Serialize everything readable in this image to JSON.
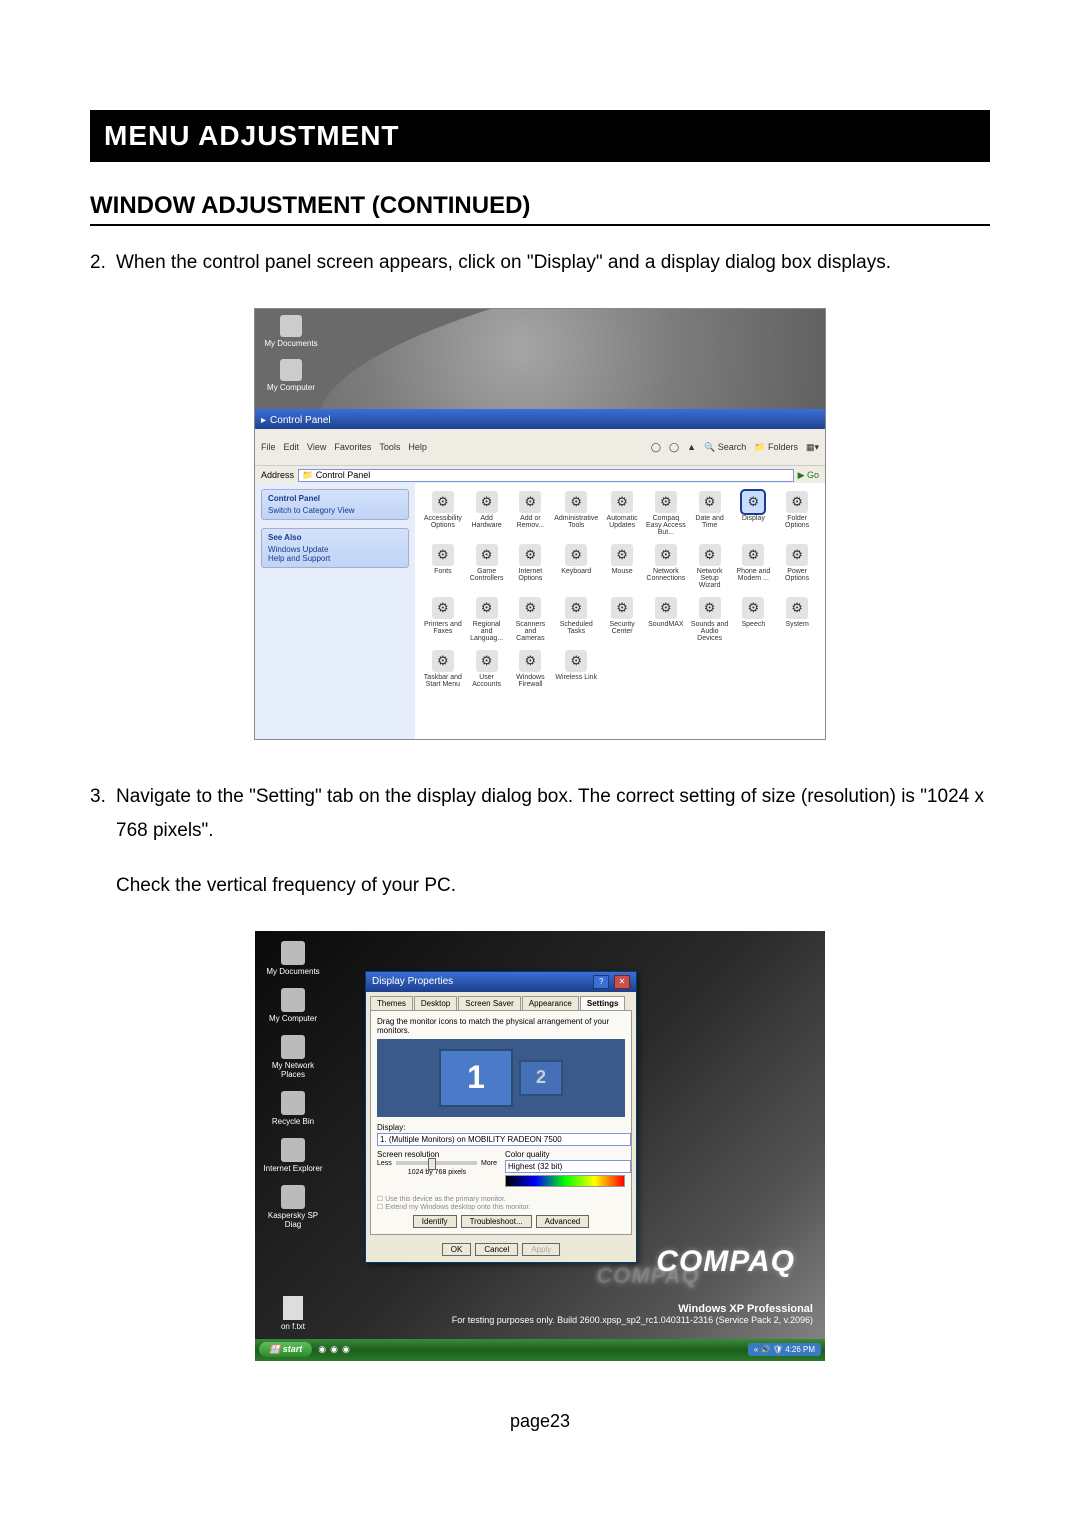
{
  "section_header": "MENU ADJUSTMENT",
  "sub_header": "WINDOW ADJUSTMENT (CONTINUED)",
  "step2_num": "2.",
  "step2_text": "When the control panel screen appears, click on \"Display\" and a display dialog box displays.",
  "step3_num": "3.",
  "step3_text": "Navigate to the \"Setting\" tab on the display dialog box. The correct setting of size (resolution) is \"1024 x 768 pixels\".",
  "step3_text2": "Check the vertical frequency of your PC.",
  "page_number": "page23",
  "cp": {
    "desktop_icons": [
      "My Documents",
      "My Computer"
    ],
    "window_title": "Control Panel",
    "menu": [
      "File",
      "Edit",
      "View",
      "Favorites",
      "Tools",
      "Help"
    ],
    "toolbar": [
      "Back",
      "Search",
      "Folders"
    ],
    "address_label": "Address",
    "address_value": "Control Panel",
    "sidebar_panel1_hdr": "Control Panel",
    "sidebar_panel1_link": "Switch to Category View",
    "sidebar_panel2_hdr": "See Also",
    "sidebar_panel2_links": [
      "Windows Update",
      "Help and Support"
    ],
    "icons": [
      "Accessibility Options",
      "Add Hardware",
      "Add or Remov...",
      "Administrative Tools",
      "Automatic Updates",
      "Compaq Easy Access But...",
      "Date and Time",
      "Display",
      "Folder Options",
      "Fonts",
      "Game Controllers",
      "Internet Options",
      "Keyboard",
      "Mouse",
      "Network Connections",
      "Network Setup Wizard",
      "Phone and Modem ...",
      "Power Options",
      "Printers and Faxes",
      "Regional and Languag...",
      "Scanners and Cameras",
      "Scheduled Tasks",
      "Security Center",
      "SoundMAX",
      "Sounds and Audio Devices",
      "Speech",
      "System",
      "Taskbar and Start Menu",
      "User Accounts",
      "Windows Firewall",
      "Wireless Link"
    ],
    "highlight_index": 7
  },
  "dp": {
    "desktop_icons": [
      "My Documents",
      "My Computer",
      "My Network Places",
      "Recycle Bin",
      "Internet Explorer",
      "Kaspersky SP Diag"
    ],
    "bottom_desktop_icon": "on f.txt",
    "title": "Display Properties",
    "tabs": [
      "Themes",
      "Desktop",
      "Screen Saver",
      "Appearance",
      "Settings"
    ],
    "active_tab_index": 4,
    "drag_hint": "Drag the monitor icons to match the physical arrangement of your monitors.",
    "monitor_labels": [
      "1",
      "2"
    ],
    "display_label": "Display:",
    "display_value": "1. (Multiple Monitors) on MOBILITY RADEON 7500",
    "res_label": "Screen resolution",
    "res_less": "Less",
    "res_more": "More",
    "res_value": "1024 by 768 pixels",
    "color_label": "Color quality",
    "color_value": "Highest (32 bit)",
    "chk1": "Use this device as the primary monitor.",
    "chk2": "Extend my Windows desktop onto this monitor.",
    "mid_buttons": [
      "Identify",
      "Troubleshoot...",
      "Advanced"
    ],
    "ok": "OK",
    "cancel": "Cancel",
    "apply": "Apply",
    "brand": "COMPAQ",
    "brand_shadow": "COMPAQ",
    "edition_title": "Windows XP Professional",
    "edition_sub": "For testing purposes only. Build 2600.xpsp_sp2_rc1.040311-2316 (Service Pack 2, v.2096)",
    "start": "start",
    "clock": "4:26 PM"
  }
}
